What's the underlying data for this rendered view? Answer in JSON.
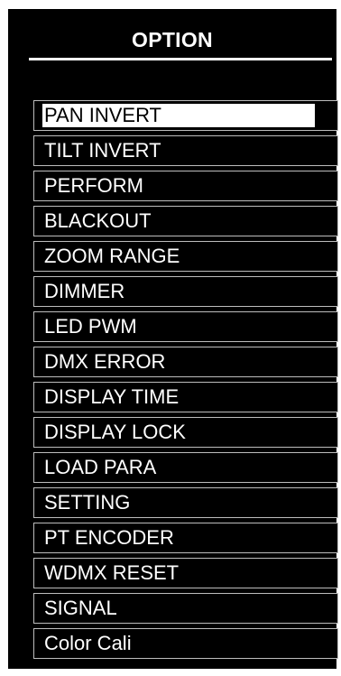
{
  "header": {
    "title": "OPTION"
  },
  "menu": {
    "selected_index": 0,
    "items": [
      {
        "label": "PAN INVERT",
        "selected": true
      },
      {
        "label": "TILT INVERT",
        "selected": false
      },
      {
        "label": "PERFORM",
        "selected": false
      },
      {
        "label": "BLACKOUT",
        "selected": false
      },
      {
        "label": "ZOOM RANGE",
        "selected": false
      },
      {
        "label": "DIMMER",
        "selected": false
      },
      {
        "label": "LED PWM",
        "selected": false
      },
      {
        "label": "DMX ERROR",
        "selected": false
      },
      {
        "label": "DISPLAY TIME",
        "selected": false
      },
      {
        "label": "DISPLAY LOCK",
        "selected": false
      },
      {
        "label": "LOAD PARA",
        "selected": false
      },
      {
        "label": "SETTING",
        "selected": false
      },
      {
        "label": "PT ENCODER",
        "selected": false
      },
      {
        "label": "WDMX RESET",
        "selected": false
      },
      {
        "label": "SIGNAL",
        "selected": false
      },
      {
        "label": "Color Cali",
        "selected": false
      }
    ]
  },
  "colors": {
    "panel_background": "#000000",
    "text": "#ffffff",
    "item_border": "#bdbdbd",
    "selection_highlight": "#ffffff",
    "selection_text": "#000000"
  }
}
